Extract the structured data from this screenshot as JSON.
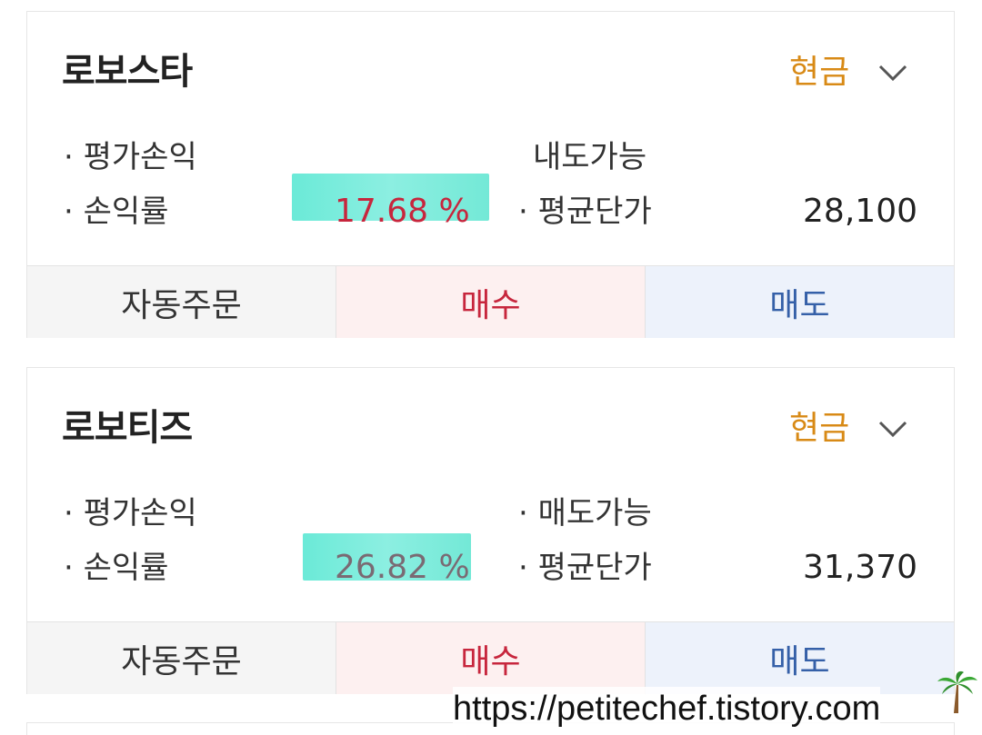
{
  "holdings": [
    {
      "name": "로보스타",
      "account_type": "현금",
      "labels": {
        "eval_pl": "· 평가손익",
        "return_rate": "· 손익률",
        "sellable": "내도가능",
        "avg_price": "· 평균단가"
      },
      "return_rate_value": "17.68 %",
      "return_rate_color": "#c7263d",
      "avg_price_value": "28,100",
      "buttons": {
        "auto_order": "자동주문",
        "buy": "매수",
        "sell": "매도"
      }
    },
    {
      "name": "로보티즈",
      "account_type": "현금",
      "labels": {
        "eval_pl": "· 평가손익",
        "return_rate": "· 손익률",
        "sellable": "· 매도가능",
        "avg_price": "· 평균단가"
      },
      "return_rate_value": "26.82 %",
      "return_rate_color": "#7a6a73",
      "avg_price_value": "31,370",
      "buttons": {
        "auto_order": "자동주문",
        "buy": "매수",
        "sell": "매도"
      }
    }
  ],
  "watermark": {
    "text": "https://petitechef.tistory.com",
    "icon": "palm-tree-icon"
  },
  "colors": {
    "account_type": "#d88a16",
    "buy": "#c7263d",
    "sell": "#3560a8",
    "highlight": "#5ee8d4"
  }
}
